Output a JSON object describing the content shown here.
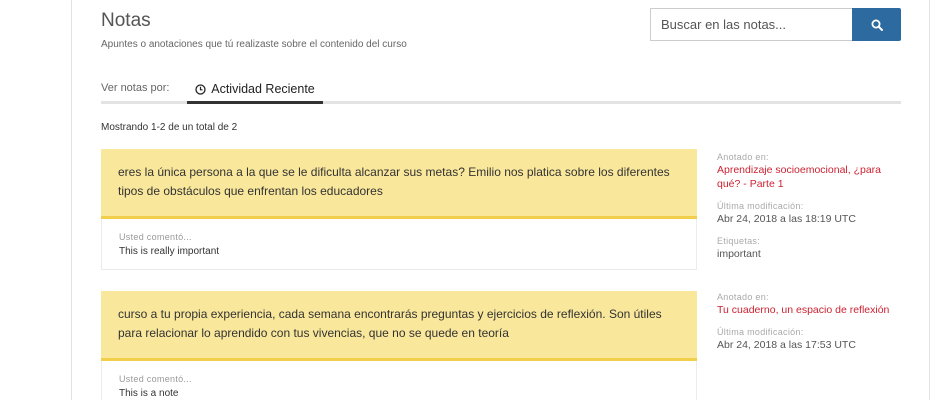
{
  "header": {
    "title": "Notas",
    "subtitle": "Apuntes o anotaciones que tú realizaste sobre el contenido del curso"
  },
  "search": {
    "placeholder": "Buscar en las notas...",
    "value": "",
    "icon": "search-icon"
  },
  "tabs": {
    "label": "Ver notas por:",
    "items": [
      {
        "label": "Actividad Reciente",
        "icon": "clock-icon",
        "active": true
      }
    ]
  },
  "results_text": "Mostrando 1-2 de un total de 2",
  "notes": [
    {
      "quote": "eres la única persona a la que se le dificulta alcanzar sus metas? Emilio nos platica sobre los diferentes tipos de obstáculos que enfrentan los educadores",
      "comment_label": "Usted comentó...",
      "comment": "This is really important",
      "meta": {
        "annotated_label": "Anotado en:",
        "annotated_link": "Aprendizaje socioemocional, ¿para qué? - Parte 1",
        "modified_label": "Última modificación:",
        "modified_value": "Abr 24, 2018 a las 18:19 UTC",
        "tags_label": "Etiquetas:",
        "tags_value": "important"
      }
    },
    {
      "quote": "curso a tu propia experiencia, cada semana encontrarás preguntas y ejercicios de reflexión. Son útiles para relacionar lo aprendido con tus vivencias, que no se quede en teoría",
      "comment_label": "Usted comentó...",
      "comment": "This is a note",
      "meta": {
        "annotated_label": "Anotado en:",
        "annotated_link": "Tu cuaderno, un espacio de reflexión",
        "modified_label": "Última modificación:",
        "modified_value": "Abr 24, 2018 a las 17:53 UTC"
      }
    }
  ],
  "colors": {
    "accent_button": "#2d6aa0",
    "highlight": "#f9e79b",
    "highlight_border": "#f1cf4b",
    "link": "#cc2231"
  }
}
